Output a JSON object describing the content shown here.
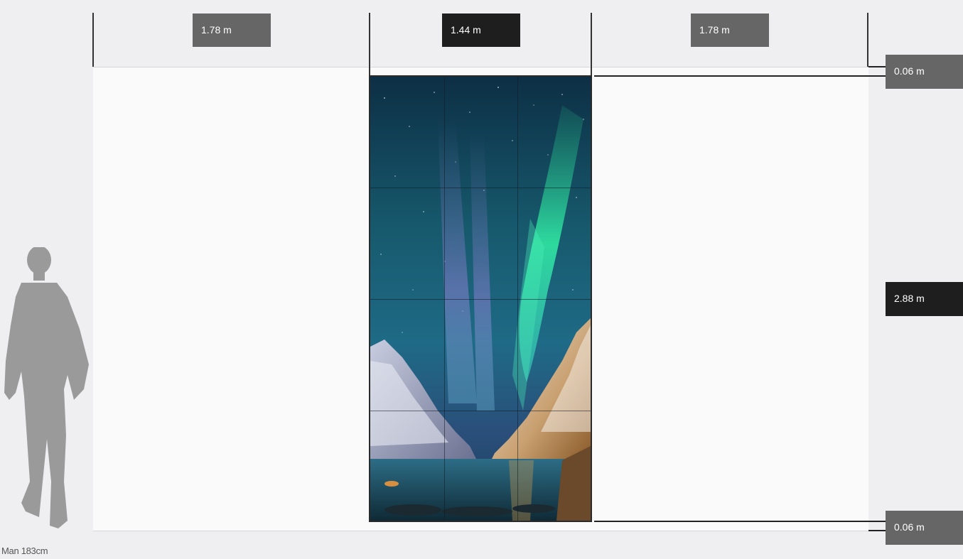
{
  "dimensions": {
    "width_left": "1.78 m",
    "width_center": "1.44 m",
    "width_right": "1.78 m",
    "bezel_top": "0.06 m",
    "height": "2.88 m",
    "bezel_bottom": "0.06 m"
  },
  "person": {
    "caption": "Man 183cm"
  },
  "video_wall": {
    "columns": 3,
    "rows": 4,
    "image_subject": "aurora-over-fjord"
  },
  "colors": {
    "background": "#efeff2",
    "wall": "#fafafa",
    "label_gray": "#666666",
    "label_dark": "#1e1e1e",
    "silhouette": "#9a9a9a"
  }
}
